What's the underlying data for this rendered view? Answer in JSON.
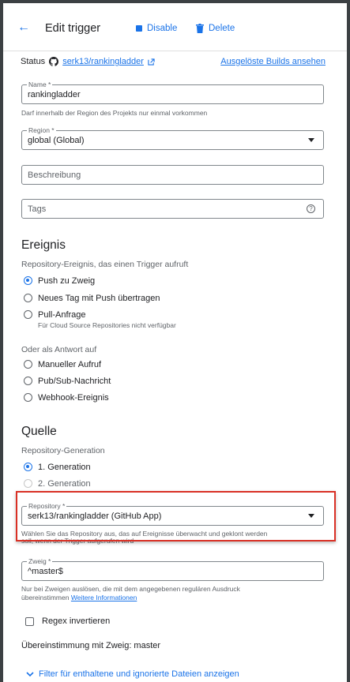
{
  "header": {
    "back_arrow": "←",
    "title": "Edit trigger",
    "disable_label": "Disable",
    "delete_label": "Delete"
  },
  "status": {
    "label": "Status",
    "repo_link": "serk13/rankingladder",
    "builds_link": "Ausgelöste Builds ansehen"
  },
  "form": {
    "name": {
      "label": "Name *",
      "value": "rankingladder",
      "help": "Darf innerhalb der Region des Projekts nur einmal vorkommen"
    },
    "region": {
      "label": "Region *",
      "value": "global (Global)"
    },
    "description": {
      "placeholder": "Beschreibung"
    },
    "tags": {
      "placeholder": "Tags",
      "help_icon": "?"
    }
  },
  "event": {
    "heading": "Ereignis",
    "sub": "Repository-Ereignis, das einen Trigger aufruft",
    "options": [
      {
        "label": "Push zu Zweig",
        "selected": true
      },
      {
        "label": "Neues Tag mit Push übertragen",
        "selected": false
      },
      {
        "label": "Pull-Anfrage",
        "selected": false,
        "note": "Für Cloud Source Repositories nicht verfügbar"
      }
    ],
    "alt_sub": "Oder als Antwort auf",
    "alt_options": [
      {
        "label": "Manueller Aufruf"
      },
      {
        "label": "Pub/Sub-Nachricht"
      },
      {
        "label": "Webhook-Ereignis"
      }
    ]
  },
  "source": {
    "heading": "Quelle",
    "sub": "Repository-Generation",
    "gen1": "1. Generation",
    "gen2": "2. Generation",
    "repository": {
      "label": "Repository *",
      "value": "serk13/rankingladder (GitHub App)",
      "help_line1": "Wählen Sie das Repository aus, das auf Ereignisse überwacht und geklont werden",
      "help_line2": "soll, wenn der Trigger aufgerufen wird"
    },
    "branch": {
      "label": "Zweig *",
      "value": "^master$",
      "help_line1": "Nur bei Zweigen auslösen, die mit dem angegebenen regulären Ausdruck",
      "help_line2_prefix": "übereinstimmen",
      "help_link": "Weitere Informationen"
    },
    "invert_regex": "Regex invertieren",
    "match_text": "Übereinstimmung mit Zweig: master",
    "filter_link": "Filter für enthaltene und ignorierte Dateien anzeigen"
  },
  "colors": {
    "accent": "#1a73e8",
    "highlight": "#d93025"
  }
}
